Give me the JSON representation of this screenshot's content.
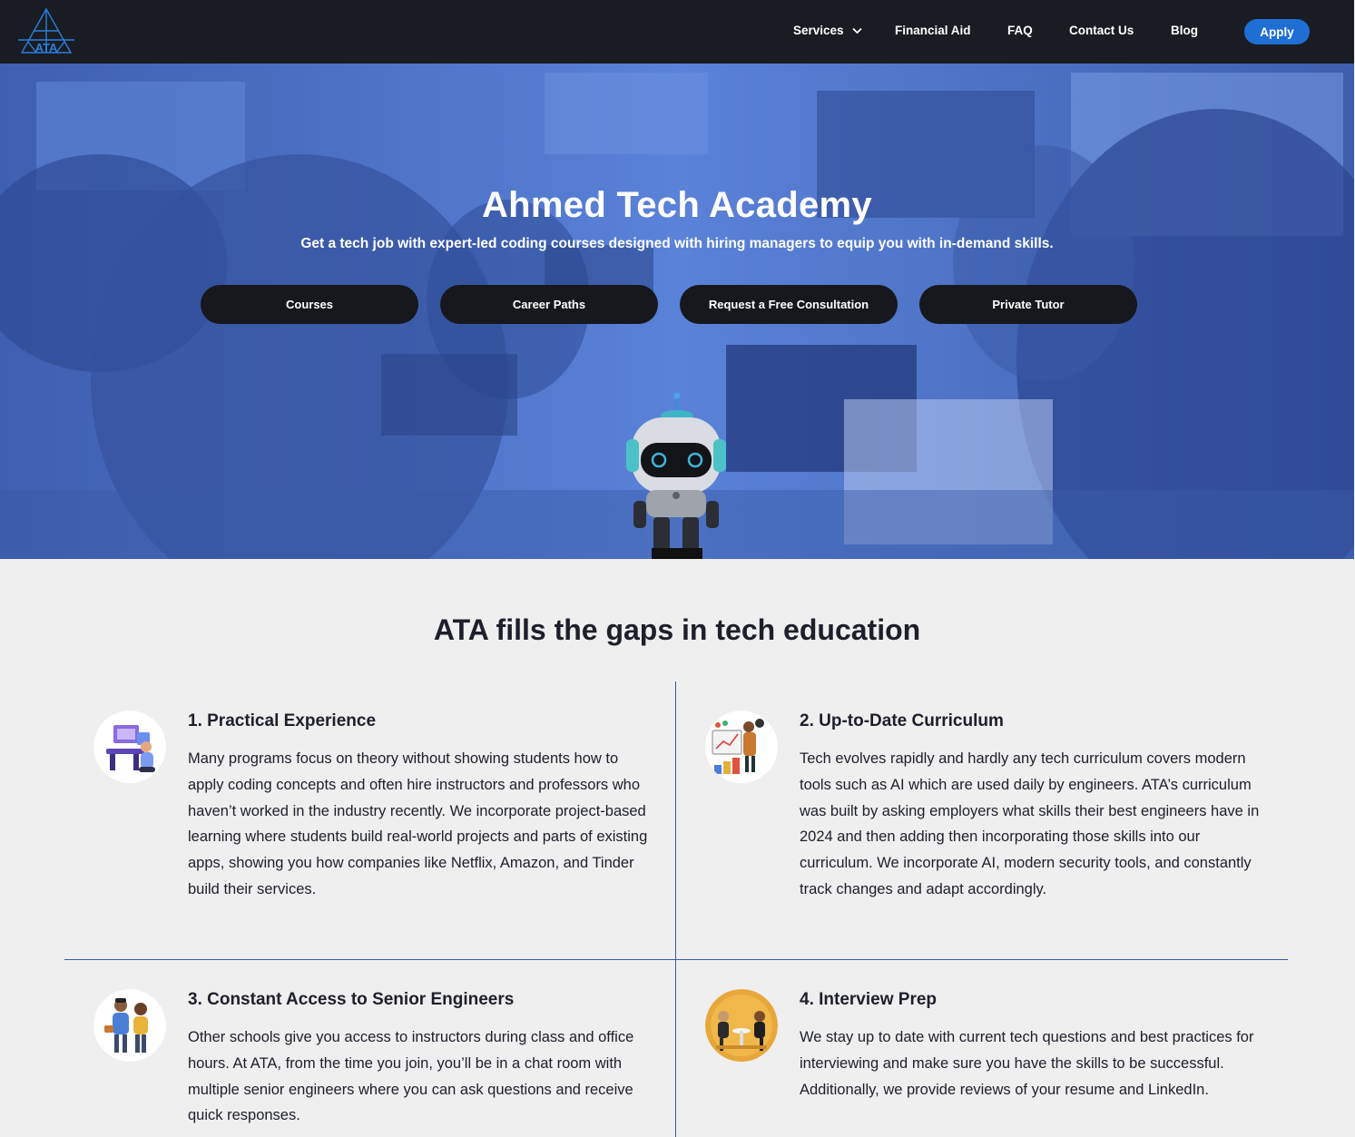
{
  "nav": {
    "logo_text": "ATA",
    "items": [
      {
        "label": "Services"
      },
      {
        "label": "Financial Aid"
      },
      {
        "label": "FAQ"
      },
      {
        "label": "Contact Us"
      },
      {
        "label": "Blog"
      }
    ],
    "apply_label": "Apply"
  },
  "hero": {
    "title": "Ahmed Tech Academy",
    "subtitle": "Get a tech job with expert-led coding courses designed with hiring managers to equip you with in-demand skills.",
    "buttons": [
      {
        "label": "Courses"
      },
      {
        "label": "Career Paths"
      },
      {
        "label": "Request a Free Consultation"
      },
      {
        "label": "Private Tutor"
      }
    ]
  },
  "section": {
    "title": "ATA fills the gaps in tech education",
    "features": [
      {
        "title": "1. Practical Experience",
        "text": "Many programs focus on theory without showing students how to apply coding concepts and often hire instructors and professors who haven’t worked in the industry recently. We incorporate project-based learning where students build real-world projects and parts of existing apps, showing you how companies like Netflix, Amazon, and Tinder build their services."
      },
      {
        "title": "2. Up-to-Date Curriculum",
        "text": "Tech evolves rapidly and hardly any tech curriculum covers modern tools such as AI which are used daily by engineers. ATA’s curriculum was built by asking employers what skills their best engineers have in 2024 and then adding then incorporating those skills into our curriculum. We incorporate AI, modern security tools, and constantly track changes and adapt accordingly."
      },
      {
        "title": "3. Constant Access to Senior Engineers",
        "text": "Other schools give you access to instructors during class and office hours. At ATA, from the time you join, you’ll be in a chat room with multiple senior engineers where you can ask questions and receive quick responses."
      },
      {
        "title": "4. Interview Prep",
        "text": "We stay up to date with current tech questions and best practices for interviewing and make sure you have the skills to be successful. Additionally, we provide reviews of your resume and LinkedIn."
      }
    ]
  },
  "colors": {
    "nav_bg": "#191c22",
    "accent": "#1f6ed4",
    "hero_tint": "#4a72c8",
    "divider": "#3a5aa8"
  }
}
